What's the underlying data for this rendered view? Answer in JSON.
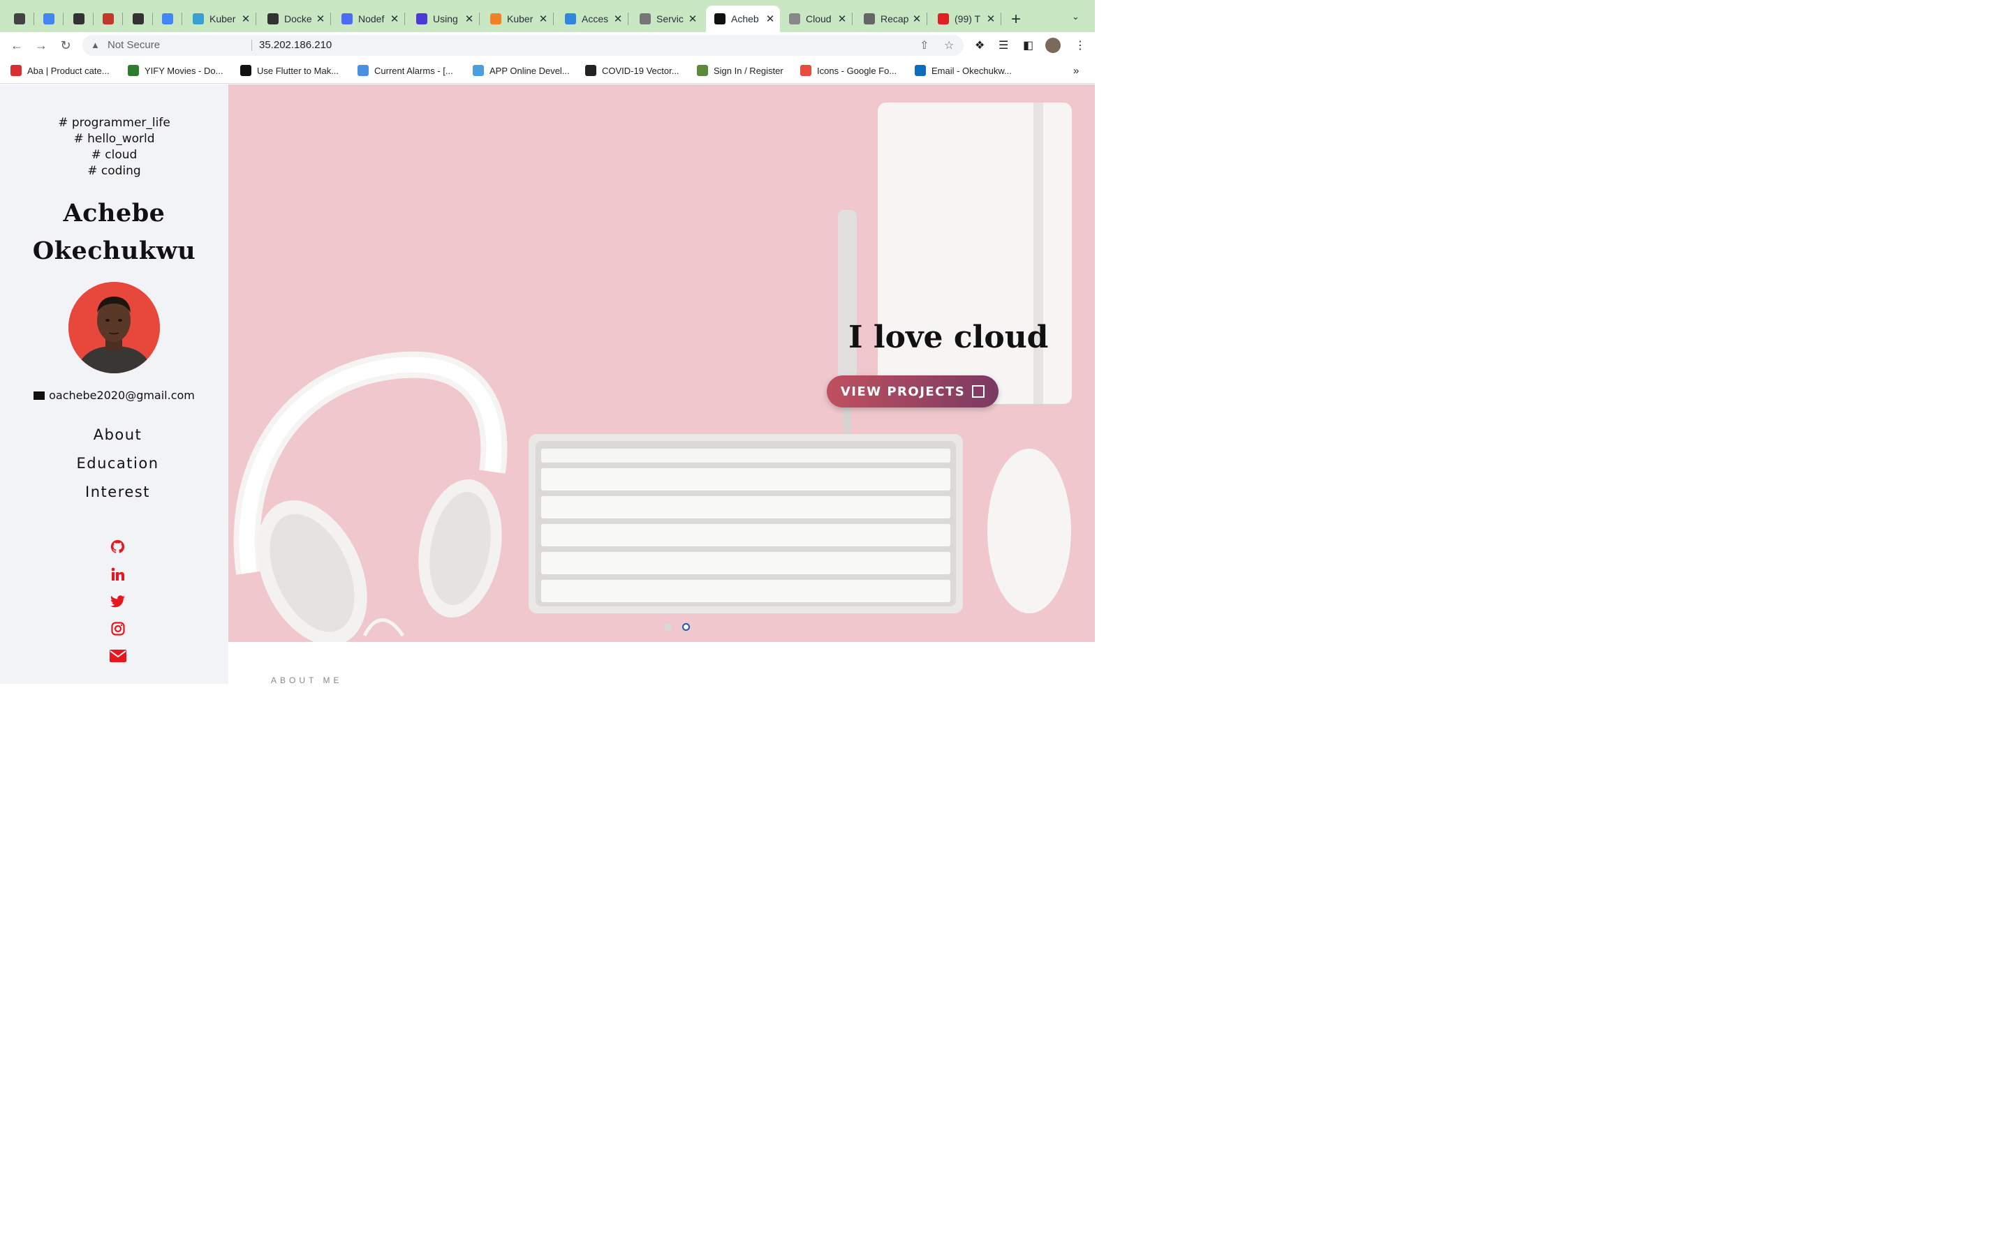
{
  "browser": {
    "tabs": [
      {
        "title": "",
        "color": "#444"
      },
      {
        "title": "",
        "color": "#4285f4"
      },
      {
        "title": "",
        "color": "#333"
      },
      {
        "title": "",
        "color": "#c0392b"
      },
      {
        "title": "",
        "color": "#333"
      },
      {
        "title": "",
        "color": "#4285f4"
      },
      {
        "title": "Kuber",
        "color": "#3aa0d0"
      },
      {
        "title": "Docke",
        "color": "#333"
      },
      {
        "title": "Nodef",
        "color": "#4a6cf7"
      },
      {
        "title": "Using",
        "color": "#4b3bd6"
      },
      {
        "title": "Kuber",
        "color": "#f48024"
      },
      {
        "title": "Acces",
        "color": "#2e86de"
      },
      {
        "title": "Servic",
        "color": "#777"
      },
      {
        "title": "Acheb",
        "color": "#111"
      },
      {
        "title": "Cloud",
        "color": "#888"
      },
      {
        "title": "Recap",
        "color": "#666"
      },
      {
        "title": "(99) T",
        "color": "#e02020"
      }
    ],
    "active_tab_index": 13,
    "address": {
      "security_label": "Not Secure",
      "url": "35.202.186.210"
    },
    "bookmarks": [
      {
        "label": "Aba | Product cate...",
        "color": "#d63031"
      },
      {
        "label": "YIFY Movies - Do...",
        "color": "#2d7d2d"
      },
      {
        "label": "Use Flutter to Mak...",
        "color": "#111"
      },
      {
        "label": "Current Alarms - [...",
        "color": "#4a90e2"
      },
      {
        "label": "APP Online Devel...",
        "color": "#4a9fe0"
      },
      {
        "label": "COVID-19 Vector...",
        "color": "#222"
      },
      {
        "label": "Sign In / Register",
        "color": "#5a8a3a"
      },
      {
        "label": "Icons - Google Fo...",
        "color": "#e74c3c"
      },
      {
        "label": "Email - Okechukw...",
        "color": "#0f6cbd"
      }
    ],
    "bookmarks_overflow": "»"
  },
  "sidebar": {
    "tags": [
      "# programmer_life",
      "# hello_world",
      "# cloud",
      "# coding"
    ],
    "name_line1": "Achebe",
    "name_line2": "Okechukwu",
    "email": "oachebe2020@gmail.com",
    "nav": [
      "About",
      "Education",
      "Interest"
    ],
    "social_icons": [
      "github-icon",
      "linkedin-icon",
      "twitter-icon",
      "instagram-icon",
      "mail-icon"
    ],
    "accent_color": "#e8171f"
  },
  "hero": {
    "title": "I love cloud",
    "button_label": "VIEW PROJECTS",
    "slides": 2,
    "active_slide": 2,
    "background_color": "#efc7cc"
  },
  "about": {
    "label": "ABOUT ME"
  }
}
